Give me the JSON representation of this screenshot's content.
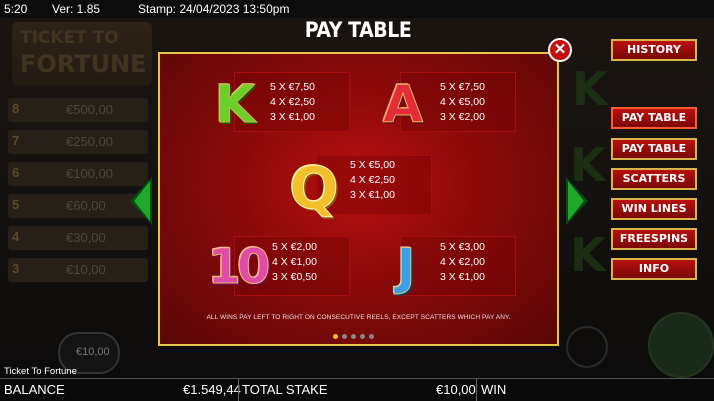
{
  "status_bar": {
    "time": "5:20",
    "version": "Ver: 1.85",
    "stamp": "Stamp: 24/04/2023 13:50pm"
  },
  "background": {
    "logo_line1": "TICKET TO",
    "logo_line2": "FORTUNE",
    "ladder": [
      {
        "num": "8",
        "value": "€500,00"
      },
      {
        "num": "7",
        "value": "€250,00"
      },
      {
        "num": "6",
        "value": "€100,00"
      },
      {
        "num": "5",
        "value": "€60,00"
      },
      {
        "num": "4",
        "value": "€30,00"
      },
      {
        "num": "3",
        "value": "€10,00"
      }
    ],
    "stake_chip": "€10,00"
  },
  "dialog": {
    "title": "PAY TABLE",
    "close_icon": "close-icon",
    "symbols": [
      {
        "symbol": "K",
        "pays": [
          "5 X €7,50",
          "4 X €2,50",
          "3 X €1,00"
        ]
      },
      {
        "symbol": "A",
        "pays": [
          "5 X €7,50",
          "4 X €5,00",
          "3 X €2,00"
        ]
      },
      {
        "symbol": "Q",
        "pays": [
          "5 X €5,00",
          "4 X €2,50",
          "3 X €1,00"
        ]
      },
      {
        "symbol": "10",
        "pays": [
          "5 X €2,00",
          "4 X €1,00",
          "3 X €0,50"
        ]
      },
      {
        "symbol": "J",
        "pays": [
          "5 X €3,00",
          "4 X €2,00",
          "3 X €1,00"
        ]
      }
    ],
    "footnote": "ALL WINS PAY LEFT TO RIGHT ON CONSECUTIVE REELS, EXCEPT SCATTERS WHICH PAY ANY.",
    "pagination": {
      "pages": 5,
      "current": 1
    }
  },
  "menu": {
    "history": "HISTORY",
    "items": [
      "PAY TABLE",
      "PAY TABLE",
      "SCATTERS",
      "WIN LINES",
      "FREESPINS",
      "INFO"
    ]
  },
  "bottom": {
    "game_name": "Ticket To Fortune",
    "balance_label": "BALANCE",
    "balance_value": "€1.549,44",
    "stake_label": "TOTAL STAKE",
    "stake_value": "€10,00",
    "win_label": "WIN"
  },
  "colors": {
    "accent_gold": "#e8c44a",
    "panel_red": "#8a0a0a",
    "arrow_green": "#1fa82a"
  }
}
